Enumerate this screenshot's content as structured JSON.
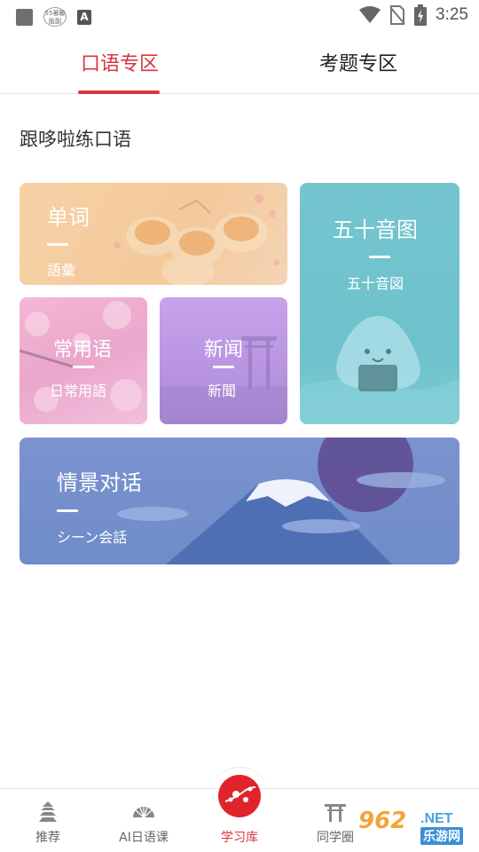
{
  "status_bar": {
    "badge_line1": "55著聯",
    "badge_line2": "胎副",
    "a_icon": "A",
    "time": "3:25"
  },
  "tabs": [
    {
      "label": "口语专区",
      "active": true
    },
    {
      "label": "考题专区",
      "active": false
    }
  ],
  "section_title": "跟哆啦练口语",
  "cards": {
    "words": {
      "title": "单词",
      "subtitle": "語彙"
    },
    "kana": {
      "title": "五十音图",
      "subtitle": "五十音図"
    },
    "common": {
      "title": "常用语",
      "subtitle": "日常用語"
    },
    "news": {
      "title": "新闻",
      "subtitle": "新聞"
    },
    "dialog": {
      "title": "情景对话",
      "subtitle": "シーン会話"
    }
  },
  "bottom_nav": [
    {
      "label": "推荐",
      "icon": "pagoda-icon"
    },
    {
      "label": "AI日语课",
      "icon": "fan-icon"
    },
    {
      "label": "学习库",
      "icon": "plum-blossom-icon",
      "active": true
    },
    {
      "label": "同学圈",
      "icon": "torii-icon"
    }
  ],
  "watermark": {
    "brand": "962",
    "suffix": ".NET",
    "cn": "乐游网"
  },
  "colors": {
    "accent": "#d9363e",
    "kana_card": "#6ec2cc",
    "dialog_card": "#6f8cc9",
    "words_card": "#f4c99b",
    "common_card": "#eaa6cc",
    "news_card": "#b995e2"
  }
}
